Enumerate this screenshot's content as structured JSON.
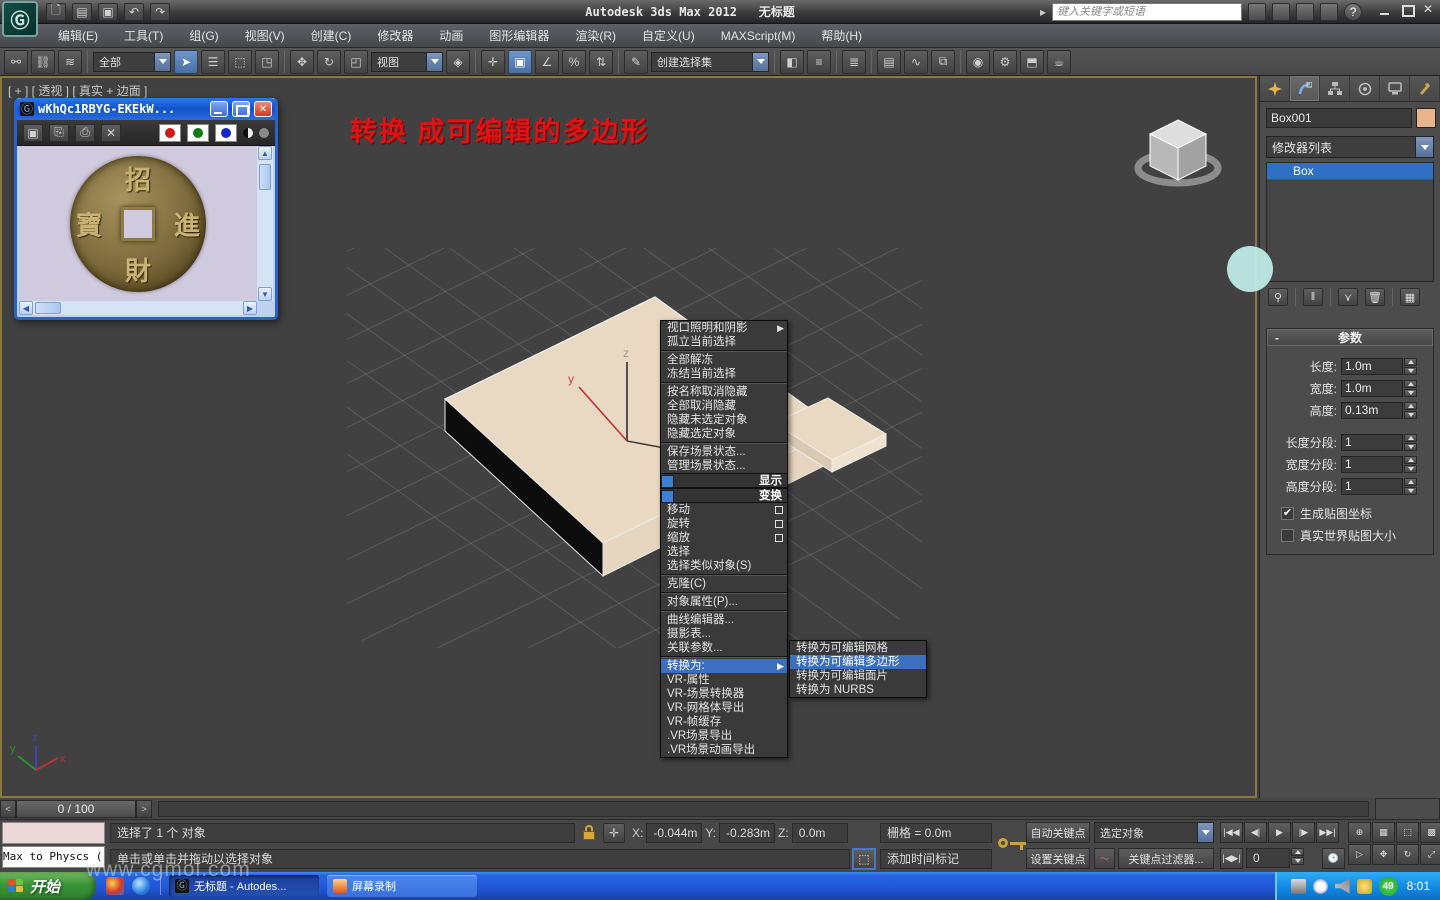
{
  "icons": {
    "logo_glyph": "Ⓖ",
    "submenu_arrow": "▶",
    "check": "✔",
    "rollout_minus": "-",
    "scroll_up": "▲",
    "scroll_down": "▼",
    "scroll_left": "◀",
    "scroll_right": "▶",
    "pb_start": "|◀◀",
    "pb_prev": "◀|",
    "pb_play": "▶",
    "pb_next": "|▶",
    "pb_end": "▶▶|",
    "key_mode": "|◀▶|",
    "ts_prev": "<",
    "ts_next": ">",
    "wave": "〜",
    "close_x": "✕"
  },
  "titlebar": {
    "app_title": "Autodesk 3ds Max  2012",
    "doc_title": "无标题",
    "search_placeholder": "键入关键字或短语"
  },
  "menus": [
    "编辑(E)",
    "工具(T)",
    "组(G)",
    "视图(V)",
    "创建(C)",
    "修改器",
    "动画",
    "图形编辑器",
    "渲染(R)",
    "自定义(U)",
    "MAXScript(M)",
    "帮助(H)"
  ],
  "toolbar": {
    "selection_filter": "全部",
    "ref_coord": "视图",
    "named_sets": "创建选择集"
  },
  "viewport": {
    "label": "[ + ] [ 透视 ] [ 真实 + 边面 ]",
    "annotation": "转换 成可编辑的多边形",
    "axis": {
      "x": "x",
      "y": "y",
      "z": "z"
    }
  },
  "image_window": {
    "title": "wKhQc1RBYG-EKEkW...",
    "coin": {
      "top": "招",
      "right": "進",
      "bottom": "財",
      "left": "寶"
    }
  },
  "context_menu": {
    "items": [
      {
        "label": "视口照明和阴影",
        "arrow": true
      },
      {
        "label": "孤立当前选择"
      },
      {
        "sep": true
      },
      {
        "label": "全部解冻"
      },
      {
        "label": "冻结当前选择"
      },
      {
        "sep": true
      },
      {
        "label": "按名称取消隐藏"
      },
      {
        "label": "全部取消隐藏"
      },
      {
        "label": "隐藏未选定对象"
      },
      {
        "label": "隐藏选定对象"
      },
      {
        "sep": true
      },
      {
        "label": "保存场景状态..."
      },
      {
        "label": "管理场景状态..."
      },
      {
        "header": "显示"
      },
      {
        "header": "变换"
      },
      {
        "label": "移动",
        "box": true
      },
      {
        "label": "旋转",
        "box": true
      },
      {
        "label": "缩放",
        "box": true
      },
      {
        "label": "选择"
      },
      {
        "label": "选择类似对象(S)"
      },
      {
        "sep": true
      },
      {
        "label": "克隆(C)"
      },
      {
        "sep": true
      },
      {
        "label": "对象属性(P)..."
      },
      {
        "sep": true
      },
      {
        "label": "曲线编辑器..."
      },
      {
        "label": "摄影表..."
      },
      {
        "label": "关联参数..."
      },
      {
        "sep": true
      },
      {
        "label": "转换为:",
        "arrow": true,
        "hl": true
      },
      {
        "label": "VR-属性"
      },
      {
        "label": "VR-场景转换器"
      },
      {
        "label": "VR-网格体导出"
      },
      {
        "label": "VR-帧缓存"
      },
      {
        "label": ".VR场景导出"
      },
      {
        "label": ".VR场景动画导出"
      }
    ],
    "submenu": [
      {
        "label": "转换为可编辑网格"
      },
      {
        "label": "转换为可编辑多边形",
        "hl": true
      },
      {
        "label": "转换为可编辑面片"
      },
      {
        "label": "转换为 NURBS"
      }
    ]
  },
  "command_panel": {
    "object_name": "Box001",
    "modifier_list": "修改器列表",
    "stack": [
      "Box"
    ],
    "rollout_title": "参数",
    "params": [
      {
        "label": "长度:",
        "value": "1.0m"
      },
      {
        "label": "宽度:",
        "value": "1.0m"
      },
      {
        "label": "高度:",
        "value": "0.13m"
      },
      {
        "gap": true
      },
      {
        "label": "长度分段:",
        "value": "1"
      },
      {
        "label": "宽度分段:",
        "value": "1"
      },
      {
        "label": "高度分段:",
        "value": "1"
      }
    ],
    "checkboxes": [
      {
        "label": "生成贴图坐标",
        "checked": true
      },
      {
        "label": "真实世界贴图大小",
        "checked": false
      }
    ],
    "swatch_color": "#e8b48c"
  },
  "status_bar": {
    "time_slider": "0 / 100",
    "listener_line": "Max to Physcs (",
    "selection": "选择了 1 个 对象",
    "prompt": "单击或单击并拖动以选择对象",
    "x_label": "X:",
    "y_label": "Y:",
    "z_label": "Z:",
    "x": "-0.044m",
    "y": "-0.283m",
    "z": "0.0m",
    "grid": "栅格 = 0.0m",
    "add_time_tag": "添加时间标记",
    "auto_key": "自动关键点",
    "set_key": "设置关键点",
    "sel_set": "选定对象",
    "key_filters": "关键点过滤器...",
    "frame": "0"
  },
  "taskbar": {
    "start": "开始",
    "tasks": [
      {
        "label": "无标题 - Autodes...",
        "active": true
      },
      {
        "label": "屏幕录制",
        "active": false
      }
    ],
    "badge": "49",
    "clock": "8:01"
  },
  "watermark": "www.cgmol.com",
  "colors": {
    "accent_blue": "#3d6fc0",
    "viewport_bg": "#414141",
    "xp_blue": "#2157d8",
    "start_green": "#3a9437"
  }
}
